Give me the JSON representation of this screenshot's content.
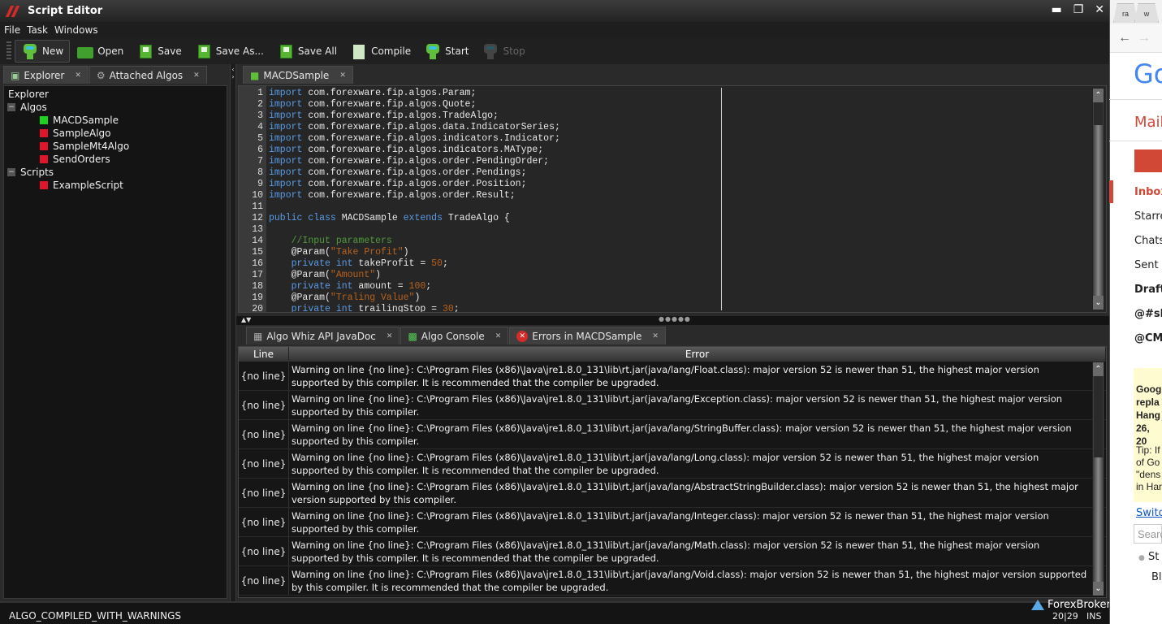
{
  "window": {
    "title": "Script Editor",
    "controls": [
      "minimize-icon",
      "restore-icon",
      "close-icon"
    ]
  },
  "menu": [
    "File",
    "Task",
    "Windows"
  ],
  "toolbar": {
    "new": "New",
    "open": "Open",
    "save": "Save",
    "save_as": "Save As...",
    "save_all": "Save All",
    "compile": "Compile",
    "start": "Start",
    "stop": "Stop"
  },
  "side_tabs": [
    {
      "label": "Explorer"
    },
    {
      "label": "Attached Algos"
    }
  ],
  "explorer": {
    "root": "Explorer",
    "groups": [
      {
        "label": "Algos",
        "items": [
          {
            "label": "MACDSample",
            "status": "green",
            "color": "#1fd11f"
          },
          {
            "label": "SampleAlgo",
            "status": "red",
            "color": "#e0142a"
          },
          {
            "label": "SampleMt4Algo",
            "status": "red",
            "color": "#e0142a"
          },
          {
            "label": "SendOrders",
            "status": "red",
            "color": "#e0142a"
          }
        ]
      },
      {
        "label": "Scripts",
        "items": [
          {
            "label": "ExampleScript",
            "status": "red",
            "color": "#e0142a"
          }
        ]
      }
    ]
  },
  "editor": {
    "tab": "MACDSample",
    "lines": [
      {
        "n": "1",
        "tokens": [
          [
            "kw",
            "import"
          ],
          [
            "tx",
            " com.forexware.fip.algos.Param;"
          ]
        ]
      },
      {
        "n": "2",
        "tokens": [
          [
            "kw",
            "import"
          ],
          [
            "tx",
            " com.forexware.fip.algos.Quote;"
          ]
        ]
      },
      {
        "n": "3",
        "tokens": [
          [
            "kw",
            "import"
          ],
          [
            "tx",
            " com.forexware.fip.algos.TradeAlgo;"
          ]
        ]
      },
      {
        "n": "4",
        "tokens": [
          [
            "kw",
            "import"
          ],
          [
            "tx",
            " com.forexware.fip.algos.data.IndicatorSeries;"
          ]
        ]
      },
      {
        "n": "5",
        "tokens": [
          [
            "kw",
            "import"
          ],
          [
            "tx",
            " com.forexware.fip.algos.indicators.Indicator;"
          ]
        ]
      },
      {
        "n": "6",
        "tokens": [
          [
            "kw",
            "import"
          ],
          [
            "tx",
            " com.forexware.fip.algos.indicators.MAType;"
          ]
        ]
      },
      {
        "n": "7",
        "tokens": [
          [
            "kw",
            "import"
          ],
          [
            "tx",
            " com.forexware.fip.algos.order.PendingOrder;"
          ]
        ]
      },
      {
        "n": "8",
        "tokens": [
          [
            "kw",
            "import"
          ],
          [
            "tx",
            " com.forexware.fip.algos.order.Pendings;"
          ]
        ]
      },
      {
        "n": "9",
        "tokens": [
          [
            "kw",
            "import"
          ],
          [
            "tx",
            " com.forexware.fip.algos.order.Position;"
          ]
        ]
      },
      {
        "n": "10",
        "tokens": [
          [
            "kw",
            "import"
          ],
          [
            "tx",
            " com.forexware.fip.algos.order.Result;"
          ]
        ]
      },
      {
        "n": "11",
        "tokens": []
      },
      {
        "n": "12",
        "tokens": [
          [
            "kw",
            "public class"
          ],
          [
            "tx",
            " MACDSample "
          ],
          [
            "kw",
            "extends"
          ],
          [
            "tx",
            " TradeAlgo {"
          ]
        ]
      },
      {
        "n": "13",
        "tokens": []
      },
      {
        "n": "14",
        "tokens": [
          [
            "tx",
            "    "
          ],
          [
            "cm",
            "//Input parameters"
          ]
        ]
      },
      {
        "n": "15",
        "tokens": [
          [
            "tx",
            "    @Param("
          ],
          [
            "str",
            "\"Take Profit\""
          ],
          [
            "tx",
            ")"
          ]
        ]
      },
      {
        "n": "16",
        "tokens": [
          [
            "tx",
            "    "
          ],
          [
            "kw",
            "private int"
          ],
          [
            "tx",
            " takeProfit = "
          ],
          [
            "num",
            "50"
          ],
          [
            "tx",
            ";"
          ]
        ]
      },
      {
        "n": "17",
        "tokens": [
          [
            "tx",
            "    @Param("
          ],
          [
            "str",
            "\"Amount\""
          ],
          [
            "tx",
            ")"
          ]
        ]
      },
      {
        "n": "18",
        "tokens": [
          [
            "tx",
            "    "
          ],
          [
            "kw",
            "private int"
          ],
          [
            "tx",
            " amount = "
          ],
          [
            "num",
            "100"
          ],
          [
            "tx",
            ";"
          ]
        ]
      },
      {
        "n": "19",
        "tokens": [
          [
            "tx",
            "    @Param("
          ],
          [
            "str",
            "\"Traling Value\""
          ],
          [
            "tx",
            ")"
          ]
        ]
      },
      {
        "n": "20",
        "tokens": [
          [
            "tx",
            "    "
          ],
          [
            "kw",
            "private int"
          ],
          [
            "tx",
            " trailingStop = "
          ],
          [
            "num",
            "30"
          ],
          [
            "tx",
            ";"
          ]
        ]
      }
    ]
  },
  "bottom_tabs": [
    {
      "label": "Algo Whiz API JavaDoc"
    },
    {
      "label": "Algo Console"
    },
    {
      "label": "Errors in MACDSample"
    }
  ],
  "errors": {
    "columns": [
      "Line",
      "Error"
    ],
    "rows": [
      {
        "line": "{no line}",
        "error": "Warning on line {no line}: C:\\Program Files (x86)\\Java\\jre1.8.0_131\\lib\\rt.jar(java/lang/Float.class): major version 52 is newer than 51, the highest major version supported by this compiler. It is recommended that the compiler be upgraded."
      },
      {
        "line": "{no line}",
        "error": "Warning on line {no line}: C:\\Program Files (x86)\\Java\\jre1.8.0_131\\lib\\rt.jar(java/lang/Exception.class): major version 52 is newer than 51, the highest major version supported by this compiler."
      },
      {
        "line": "{no line}",
        "error": "Warning on line {no line}: C:\\Program Files (x86)\\Java\\jre1.8.0_131\\lib\\rt.jar(java/lang/StringBuffer.class): major version 52 is newer than 51, the highest major version supported by this compiler."
      },
      {
        "line": "{no line}",
        "error": "Warning on line {no line}: C:\\Program Files (x86)\\Java\\jre1.8.0_131\\lib\\rt.jar(java/lang/Long.class): major version 52 is newer than 51, the highest major version supported by this compiler. It is recommended that the compiler be upgraded."
      },
      {
        "line": "{no line}",
        "error": "Warning on line {no line}: C:\\Program Files (x86)\\Java\\jre1.8.0_131\\lib\\rt.jar(java/lang/AbstractStringBuilder.class): major version 52 is newer than 51, the highest major version supported by this compiler."
      },
      {
        "line": "{no line}",
        "error": "Warning on line {no line}: C:\\Program Files (x86)\\Java\\jre1.8.0_131\\lib\\rt.jar(java/lang/Integer.class): major version 52 is newer than 51, the highest major version supported by this compiler."
      },
      {
        "line": "{no line}",
        "error": "Warning on line {no line}: C:\\Program Files (x86)\\Java\\jre1.8.0_131\\lib\\rt.jar(java/lang/Math.class): major version 52 is newer than 51, the highest major version supported by this compiler. It is recommended that the compiler be upgraded."
      },
      {
        "line": "{no line}",
        "error": "Warning on line {no line}: C:\\Program Files (x86)\\Java\\jre1.8.0_131\\lib\\rt.jar(java/lang/Void.class): major version 52 is newer than 51, the highest major version supported by this compiler. It is recommended that the compiler be upgraded."
      }
    ]
  },
  "status": {
    "message": "ALGO_COMPILED_WITH_WARNINGS",
    "cursor": "20|29",
    "mode": "INS"
  },
  "watermark": "ForexBrokers.com",
  "browser": {
    "tabs": [
      "ra",
      "w"
    ],
    "logo": "Go",
    "app_label": "Mail",
    "nav": [
      "Inbox",
      "Starre",
      "Chats",
      "Sent N",
      "Drafts",
      "@#sla",
      "@CM"
    ],
    "notice_title": "Goog repla Hang 26, 20",
    "notice_tip": "Tip: If of Go \"dens in Har",
    "link": "Switc",
    "search_placeholder": "Searc",
    "contacts": [
      "St",
      "Bl"
    ]
  }
}
